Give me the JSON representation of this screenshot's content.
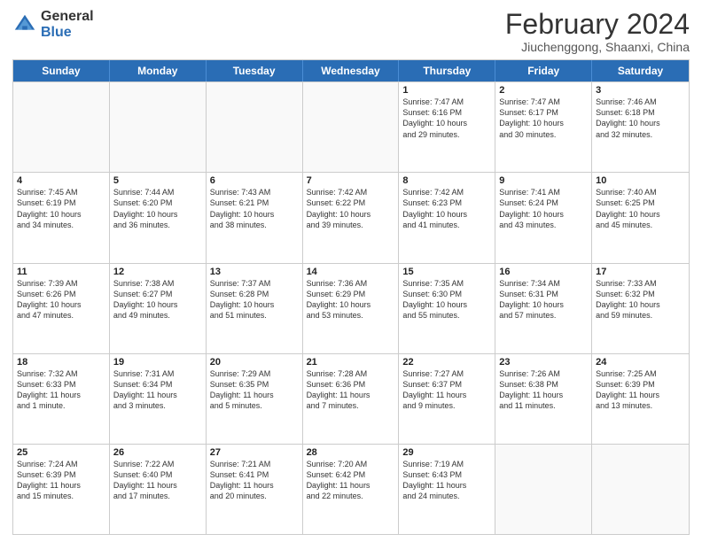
{
  "logo": {
    "general": "General",
    "blue": "Blue"
  },
  "header": {
    "title": "February 2024",
    "subtitle": "Jiuchenggong, Shaanxi, China"
  },
  "days": [
    "Sunday",
    "Monday",
    "Tuesday",
    "Wednesday",
    "Thursday",
    "Friday",
    "Saturday"
  ],
  "rows": [
    [
      {
        "day": "",
        "info": ""
      },
      {
        "day": "",
        "info": ""
      },
      {
        "day": "",
        "info": ""
      },
      {
        "day": "",
        "info": ""
      },
      {
        "day": "1",
        "info": "Sunrise: 7:47 AM\nSunset: 6:16 PM\nDaylight: 10 hours\nand 29 minutes."
      },
      {
        "day": "2",
        "info": "Sunrise: 7:47 AM\nSunset: 6:17 PM\nDaylight: 10 hours\nand 30 minutes."
      },
      {
        "day": "3",
        "info": "Sunrise: 7:46 AM\nSunset: 6:18 PM\nDaylight: 10 hours\nand 32 minutes."
      }
    ],
    [
      {
        "day": "4",
        "info": "Sunrise: 7:45 AM\nSunset: 6:19 PM\nDaylight: 10 hours\nand 34 minutes."
      },
      {
        "day": "5",
        "info": "Sunrise: 7:44 AM\nSunset: 6:20 PM\nDaylight: 10 hours\nand 36 minutes."
      },
      {
        "day": "6",
        "info": "Sunrise: 7:43 AM\nSunset: 6:21 PM\nDaylight: 10 hours\nand 38 minutes."
      },
      {
        "day": "7",
        "info": "Sunrise: 7:42 AM\nSunset: 6:22 PM\nDaylight: 10 hours\nand 39 minutes."
      },
      {
        "day": "8",
        "info": "Sunrise: 7:42 AM\nSunset: 6:23 PM\nDaylight: 10 hours\nand 41 minutes."
      },
      {
        "day": "9",
        "info": "Sunrise: 7:41 AM\nSunset: 6:24 PM\nDaylight: 10 hours\nand 43 minutes."
      },
      {
        "day": "10",
        "info": "Sunrise: 7:40 AM\nSunset: 6:25 PM\nDaylight: 10 hours\nand 45 minutes."
      }
    ],
    [
      {
        "day": "11",
        "info": "Sunrise: 7:39 AM\nSunset: 6:26 PM\nDaylight: 10 hours\nand 47 minutes."
      },
      {
        "day": "12",
        "info": "Sunrise: 7:38 AM\nSunset: 6:27 PM\nDaylight: 10 hours\nand 49 minutes."
      },
      {
        "day": "13",
        "info": "Sunrise: 7:37 AM\nSunset: 6:28 PM\nDaylight: 10 hours\nand 51 minutes."
      },
      {
        "day": "14",
        "info": "Sunrise: 7:36 AM\nSunset: 6:29 PM\nDaylight: 10 hours\nand 53 minutes."
      },
      {
        "day": "15",
        "info": "Sunrise: 7:35 AM\nSunset: 6:30 PM\nDaylight: 10 hours\nand 55 minutes."
      },
      {
        "day": "16",
        "info": "Sunrise: 7:34 AM\nSunset: 6:31 PM\nDaylight: 10 hours\nand 57 minutes."
      },
      {
        "day": "17",
        "info": "Sunrise: 7:33 AM\nSunset: 6:32 PM\nDaylight: 10 hours\nand 59 minutes."
      }
    ],
    [
      {
        "day": "18",
        "info": "Sunrise: 7:32 AM\nSunset: 6:33 PM\nDaylight: 11 hours\nand 1 minute."
      },
      {
        "day": "19",
        "info": "Sunrise: 7:31 AM\nSunset: 6:34 PM\nDaylight: 11 hours\nand 3 minutes."
      },
      {
        "day": "20",
        "info": "Sunrise: 7:29 AM\nSunset: 6:35 PM\nDaylight: 11 hours\nand 5 minutes."
      },
      {
        "day": "21",
        "info": "Sunrise: 7:28 AM\nSunset: 6:36 PM\nDaylight: 11 hours\nand 7 minutes."
      },
      {
        "day": "22",
        "info": "Sunrise: 7:27 AM\nSunset: 6:37 PM\nDaylight: 11 hours\nand 9 minutes."
      },
      {
        "day": "23",
        "info": "Sunrise: 7:26 AM\nSunset: 6:38 PM\nDaylight: 11 hours\nand 11 minutes."
      },
      {
        "day": "24",
        "info": "Sunrise: 7:25 AM\nSunset: 6:39 PM\nDaylight: 11 hours\nand 13 minutes."
      }
    ],
    [
      {
        "day": "25",
        "info": "Sunrise: 7:24 AM\nSunset: 6:39 PM\nDaylight: 11 hours\nand 15 minutes."
      },
      {
        "day": "26",
        "info": "Sunrise: 7:22 AM\nSunset: 6:40 PM\nDaylight: 11 hours\nand 17 minutes."
      },
      {
        "day": "27",
        "info": "Sunrise: 7:21 AM\nSunset: 6:41 PM\nDaylight: 11 hours\nand 20 minutes."
      },
      {
        "day": "28",
        "info": "Sunrise: 7:20 AM\nSunset: 6:42 PM\nDaylight: 11 hours\nand 22 minutes."
      },
      {
        "day": "29",
        "info": "Sunrise: 7:19 AM\nSunset: 6:43 PM\nDaylight: 11 hours\nand 24 minutes."
      },
      {
        "day": "",
        "info": ""
      },
      {
        "day": "",
        "info": ""
      }
    ]
  ]
}
